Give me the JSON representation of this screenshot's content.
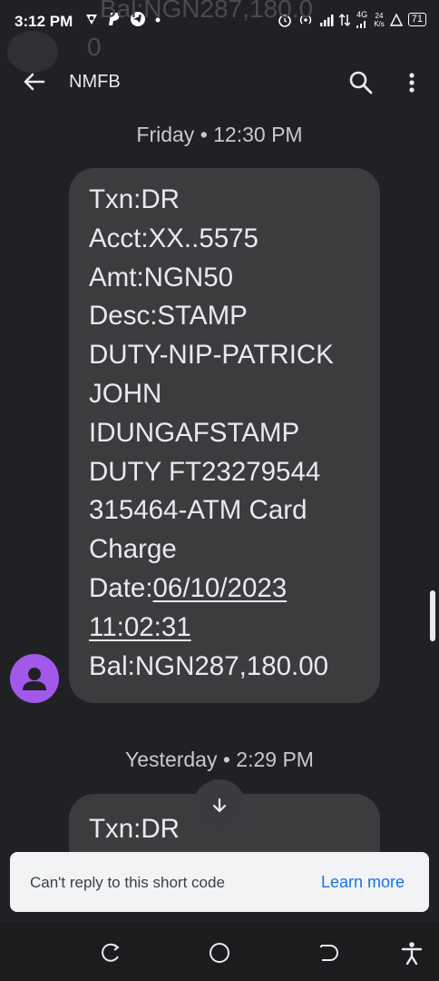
{
  "status_bar": {
    "time": "3:12 PM",
    "network": "4G",
    "speed_top": "24",
    "speed_bottom": "K/s",
    "battery": "71",
    "icons": [
      "app-icon",
      "paypal-icon",
      "telegram-icon",
      "dot-icon",
      "alarm-icon",
      "hotspot-icon",
      "signal-icon",
      "data-icon",
      "signal-4g-icon",
      "warning-icon",
      "battery-icon"
    ]
  },
  "ghost_preview": {
    "top_text": "Bal:NGN287,180.0",
    "line2": "0"
  },
  "toolbar": {
    "title": "NMFB"
  },
  "messages": [
    {
      "timestamp": "Friday • 12:30 PM",
      "lines": [
        "Txn:DR",
        "Acct:XX..5575",
        "Amt:NGN50",
        "Desc:STAMP",
        "DUTY-NIP-PATRICK",
        "JOHN",
        "IDUNGAFSTAMP",
        "DUTY FT23279544",
        "315464-ATM Card",
        "Charge"
      ],
      "date_label": "Date:",
      "date_value": "06/10/2023",
      "time_value": "11:02:31",
      "balance": "Bal:NGN287,180.00"
    },
    {
      "timestamp": "Yesterday • 2:29 PM",
      "lines": [
        "Txn:DR"
      ]
    }
  ],
  "banner": {
    "text": "Can't reply to this short code",
    "link": "Learn more"
  },
  "colors": {
    "background": "#202124",
    "bubble": "#3c3c3e",
    "avatar": "#a259ea",
    "link": "#1a73e8"
  }
}
